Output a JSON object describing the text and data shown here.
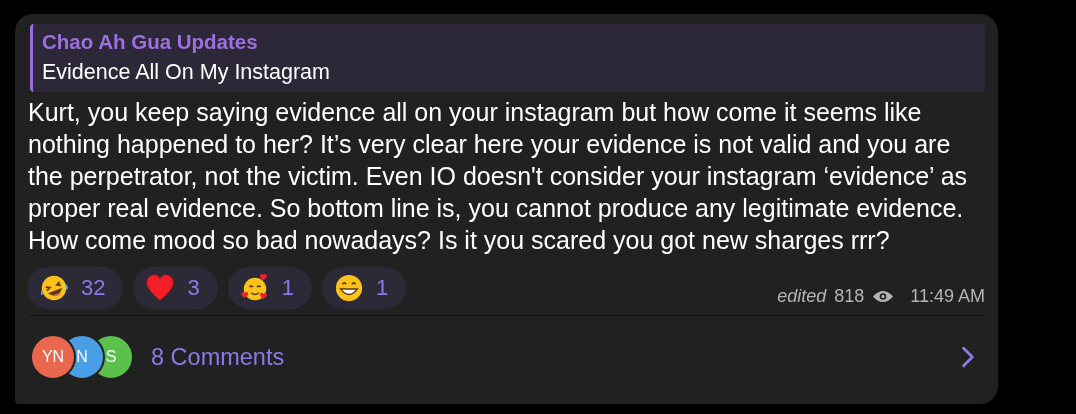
{
  "reply_quote": {
    "channel": "Chao Ah Gua Updates",
    "text": "Evidence All On My Instagram"
  },
  "message": {
    "text": "Kurt, you keep saying evidence all on your instagram but how come it seems like\nnothing happened to her? It’s very clear here your evidence is not valid and you are\nthe perpetrator, not the victim. Even IO doesn't consider your instagram ‘evidence’ as\nproper real evidence. So bottom line is, you cannot produce any legitimate evidence.\nHow come mood so bad nowadays? Is it you scared you got new sharges rrr?"
  },
  "reactions": [
    {
      "kind": "laughing",
      "count": "32"
    },
    {
      "kind": "heart",
      "count": "3"
    },
    {
      "kind": "hearts-smile",
      "count": "1"
    },
    {
      "kind": "grin",
      "count": "1"
    }
  ],
  "meta": {
    "edited": "edited",
    "views": "818",
    "time": "11:49 AM"
  },
  "comments": {
    "avatars": [
      {
        "initials": "YN",
        "color": "#e9674f"
      },
      {
        "initials": "N",
        "color": "#4a9ee6"
      },
      {
        "initials": "S",
        "color": "#5cc04d"
      }
    ],
    "label": "8 Comments"
  }
}
